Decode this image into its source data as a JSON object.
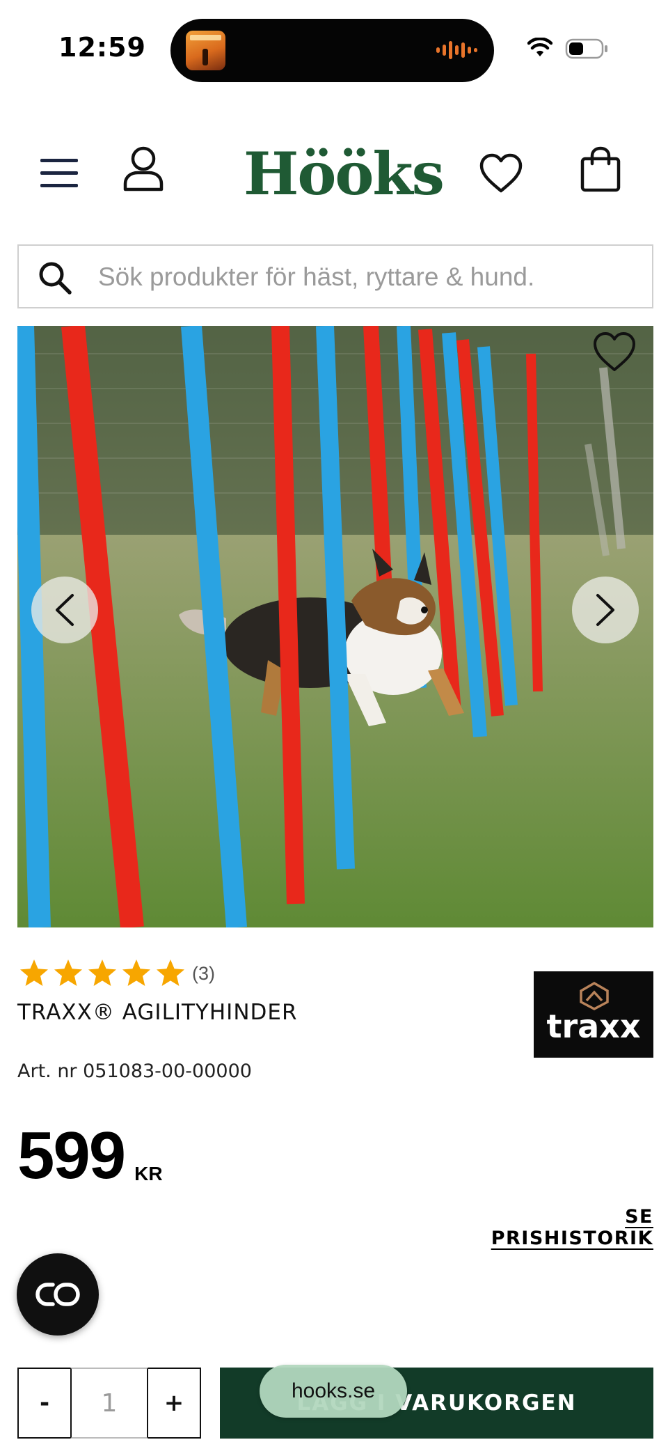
{
  "status_bar": {
    "time": "12:59"
  },
  "header": {
    "logo": "Hööks",
    "icons": [
      "menu-icon",
      "account-icon",
      "heart-icon",
      "shopping-bag-icon"
    ]
  },
  "search": {
    "placeholder": "Sök produkter för häst, ryttare & hund.",
    "value": ""
  },
  "product": {
    "rating": 5,
    "rating_max": 5,
    "review_count": "(3)",
    "brand": "traxx",
    "name": "TRAXX® AGILITYHINDER",
    "article_number": "Art. nr 051083-00-00000",
    "price": "599",
    "currency": "KR",
    "price_history_label": "SE PRISHISTORIK"
  },
  "purchase": {
    "qty_minus": "-",
    "quantity": "1",
    "qty_plus": "+",
    "add_to_cart_label": "LÄGG I VARUKORGEN"
  },
  "browser": {
    "url": "hooks.se"
  },
  "colors": {
    "brand_green": "#1f5a34",
    "cta_green": "#123b28",
    "star": "#f7a600",
    "pole_red": "#ee2a1a",
    "pole_blue": "#29a7e8"
  }
}
